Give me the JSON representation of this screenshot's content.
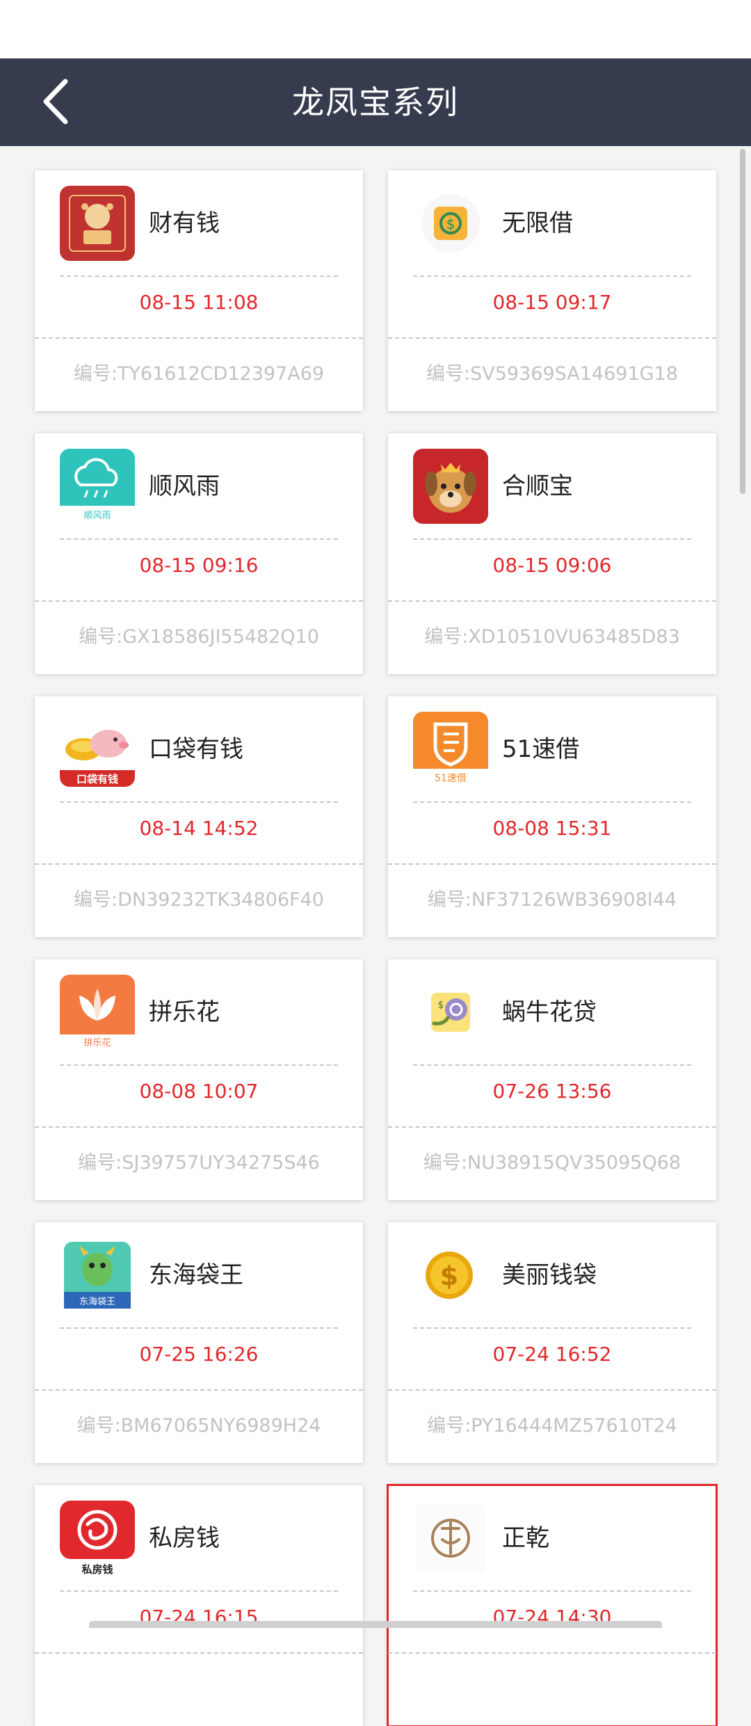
{
  "header": {
    "title": "龙凤宝系列"
  },
  "apps": [
    {
      "name": "财有钱",
      "date": "08-15 11:08",
      "code": "编号:TY61612CD12397A69",
      "icon": "red-envelope-icon"
    },
    {
      "name": "无限借",
      "date": "08-15 09:17",
      "code": "编号:SV59369SA14691G18",
      "icon": "money-exchange-icon"
    },
    {
      "name": "顺风雨",
      "date": "08-15 09:16",
      "code": "编号:GX18586JI55482Q10",
      "icon": "rain-cloud-icon",
      "icon_caption": "顺风雨"
    },
    {
      "name": "合顺宝",
      "date": "08-15 09:06",
      "code": "编号:XD10510VU63485D83",
      "icon": "dog-mascot-icon"
    },
    {
      "name": "口袋有钱",
      "date": "08-14 14:52",
      "code": "编号:DN39232TK34806F40",
      "icon": "piggy-gold-icon",
      "icon_caption": "口袋有钱"
    },
    {
      "name": "51速借",
      "date": "08-08 15:31",
      "code": "编号:NF37126WB36908I44",
      "icon": "shield-credit-icon",
      "icon_caption": "51速借"
    },
    {
      "name": "拼乐花",
      "date": "08-08 10:07",
      "code": "编号:SJ39757UY34275S46",
      "icon": "petal-flower-icon",
      "icon_caption": "拼乐花"
    },
    {
      "name": "蜗牛花贷",
      "date": "07-26 13:56",
      "code": "编号:NU38915QV35095Q68",
      "icon": "snail-coin-icon"
    },
    {
      "name": "东海袋王",
      "date": "07-25 16:26",
      "code": "编号:BM67065NY6989H24",
      "icon": "dragon-icon",
      "icon_caption": "东海袋王"
    },
    {
      "name": "美丽钱袋",
      "date": "07-24 16:52",
      "code": "编号:PY16444MZ57610T24",
      "icon": "gold-coin-icon"
    },
    {
      "name": "私房钱",
      "date": "07-24 16:15",
      "code": "",
      "icon": "red-swirl-icon",
      "icon_caption": "私房钱"
    },
    {
      "name": "正乾",
      "date": "07-24 14:30",
      "code": "",
      "icon": "bronze-seal-icon"
    }
  ],
  "colors": {
    "header_bg": "#363c4d",
    "date_red": "#e2262b",
    "code_gray": "#c2c2c2",
    "selected_border": "#e2262b"
  }
}
